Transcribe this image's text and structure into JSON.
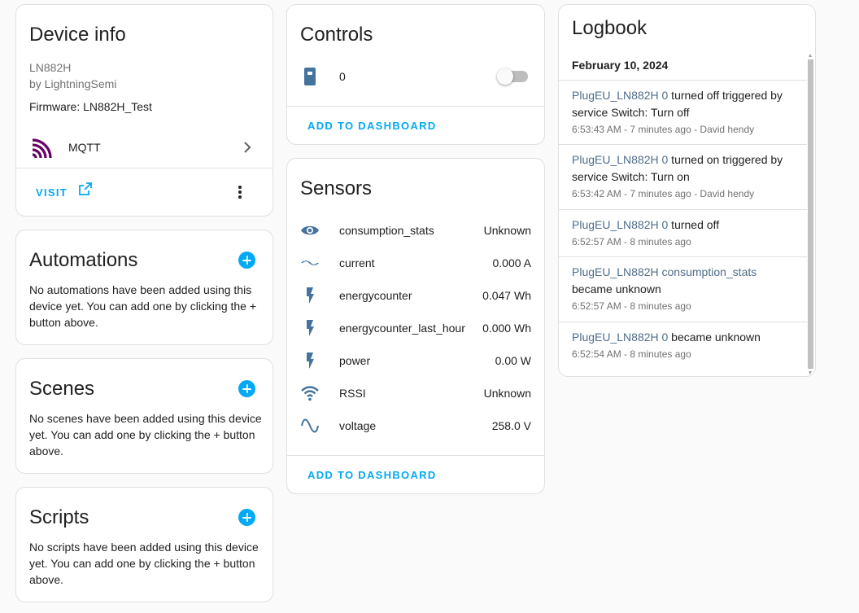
{
  "device_info": {
    "title": "Device info",
    "model": "LN882H",
    "manufacturer": "by LightningSemi",
    "firmware": "Firmware: LN882H_Test",
    "integration": "MQTT",
    "visit_label": "VISIT"
  },
  "automations": {
    "title": "Automations",
    "empty_text": "No automations have been added using this device yet. You can add one by clicking the + button above."
  },
  "scenes": {
    "title": "Scenes",
    "empty_text": "No scenes have been added using this device yet. You can add one by clicking the + button above."
  },
  "scripts": {
    "title": "Scripts",
    "empty_text": "No scripts have been added using this device yet. You can add one by clicking the + button above."
  },
  "controls": {
    "title": "Controls",
    "switch_label": "0",
    "switch_on": false,
    "add_label": "ADD TO DASHBOARD"
  },
  "sensors": {
    "title": "Sensors",
    "items": [
      {
        "name": "consumption_stats",
        "value": "Unknown",
        "icon": "eye-icon"
      },
      {
        "name": "current",
        "value": "0.000 A",
        "icon": "current-ac-icon"
      },
      {
        "name": "energycounter",
        "value": "0.047 Wh",
        "icon": "flash-icon"
      },
      {
        "name": "energycounter_last_hour",
        "value": "0.000 Wh",
        "icon": "flash-icon"
      },
      {
        "name": "power",
        "value": "0.00 W",
        "icon": "flash-icon"
      },
      {
        "name": "RSSI",
        "value": "Unknown",
        "icon": "wifi-icon"
      },
      {
        "name": "voltage",
        "value": "258.0 V",
        "icon": "sine-wave-icon"
      }
    ],
    "add_label": "ADD TO DASHBOARD"
  },
  "logbook": {
    "title": "Logbook",
    "date": "February 10, 2024",
    "entries": [
      {
        "entity": "PlugEU_LN882H 0",
        "message": " turned off triggered by service Switch: Turn off",
        "meta": "6:53:43 AM - 7 minutes ago - David hendy"
      },
      {
        "entity": "PlugEU_LN882H 0",
        "message": " turned on triggered by service Switch: Turn on",
        "meta": "6:53:42 AM - 7 minutes ago - David hendy"
      },
      {
        "entity": "PlugEU_LN882H 0",
        "message": " turned off",
        "meta": "6:52:57 AM - 8 minutes ago"
      },
      {
        "entity": "PlugEU_LN882H consumption_stats",
        "message": " became unknown",
        "meta": "6:52:57 AM - 8 minutes ago"
      },
      {
        "entity": "PlugEU_LN882H 0",
        "message": " became unknown",
        "meta": "6:52:54 AM - 8 minutes ago"
      }
    ]
  },
  "colors": {
    "accent": "#03a9f4",
    "icon": "#44739e",
    "mqtt": "#660066",
    "entity_link": "#4f6c8a"
  }
}
